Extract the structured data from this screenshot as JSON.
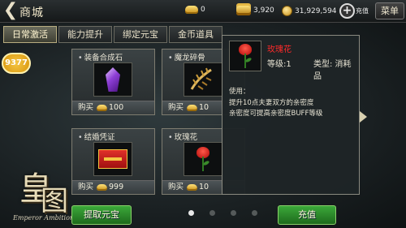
{
  "header": {
    "back_symbol": "❮",
    "title": "商城",
    "currencies": [
      {
        "icon": "gold-ingot-icon",
        "value": "0"
      },
      {
        "icon": "gold-ingot-stack-icon",
        "value": "3,920"
      },
      {
        "icon": "gold-coin-icon",
        "value": "31,929,594"
      }
    ],
    "recharge_symbol": "+",
    "recharge_label": "充值",
    "menu_label": "菜单"
  },
  "tabs": [
    {
      "label": "日常激活",
      "active": true
    },
    {
      "label": "能力提升",
      "active": false
    },
    {
      "label": "绑定元宝",
      "active": false
    },
    {
      "label": "金币道具",
      "active": false
    }
  ],
  "side_badge": "9377",
  "items": [
    {
      "name": "装备合成石",
      "buy_label": "购买",
      "price": "100",
      "icon": "purple-crystal-icon"
    },
    {
      "name": "魔龙碎骨",
      "buy_label": "购买",
      "price": "10",
      "icon": "dragon-bone-icon"
    },
    {
      "name": "结婚凭证",
      "buy_label": "购买",
      "price": "999",
      "icon": "marriage-certificate-icon"
    },
    {
      "name": "玫瑰花",
      "buy_label": "购买",
      "price": "10",
      "icon": "rose-icon"
    }
  ],
  "tooltip": {
    "name": "玫瑰花",
    "level": "等级:1",
    "type": "类型: 消耗品",
    "usage_title": "使用：",
    "usage_lines": [
      "提升10点夫妻双方的亲密度",
      "亲密度可提高亲密度BUFF等级"
    ],
    "name_color": "#ff2a2a"
  },
  "logo": {
    "glyph": "皇",
    "glyph2": "图",
    "subtitle": "Emperor Ambition"
  },
  "buttons": {
    "withdraw": "提取元宝",
    "recharge": "充值"
  },
  "pagination": {
    "count": 4,
    "active_index": 0
  }
}
